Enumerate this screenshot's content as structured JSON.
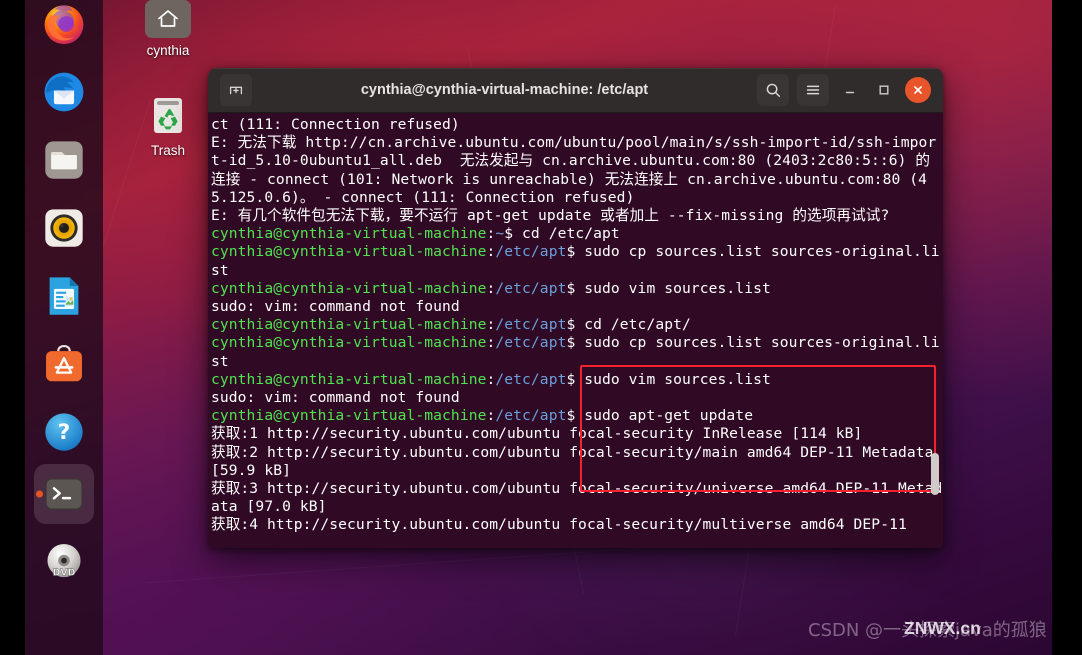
{
  "desktop": {
    "icons": [
      {
        "name": "home-folder",
        "label": "cynthia",
        "icon": "home-icon"
      },
      {
        "name": "trash",
        "label": "Trash",
        "icon": "trash-icon"
      }
    ]
  },
  "dock": {
    "items": [
      {
        "label": "Firefox",
        "icon": "firefox-icon",
        "active": false
      },
      {
        "label": "Thunderbird Mail",
        "icon": "thunderbird-icon",
        "active": false
      },
      {
        "label": "Files",
        "icon": "files-folder-icon",
        "active": false
      },
      {
        "label": "Rhythmbox",
        "icon": "rhythmbox-speaker-icon",
        "active": false
      },
      {
        "label": "LibreOffice Writer",
        "icon": "libreoffice-writer-icon",
        "active": false
      },
      {
        "label": "Ubuntu Software",
        "icon": "ubuntu-software-icon",
        "active": false
      },
      {
        "label": "Help",
        "icon": "help-question-icon",
        "active": false
      },
      {
        "label": "Terminal",
        "icon": "terminal-icon",
        "active": true
      },
      {
        "label": "DVD",
        "icon": "dvd-disc-icon",
        "active": false
      }
    ]
  },
  "terminal": {
    "title": "cynthia@cynthia-virtual-machine: /etc/apt",
    "titlebar": {
      "new_tab_label": "New Tab",
      "search_label": "Search",
      "menu_label": "Menu",
      "minimize_label": "Minimize",
      "maximize_label": "Maximize",
      "close_label": "Close"
    },
    "colors": {
      "background": "#300a24",
      "prompt_user": "#4fe44f",
      "prompt_path": "#6a9fdb",
      "text": "#ffffff",
      "annotation_red": "#f4212e",
      "close_button": "#e9552a"
    },
    "prompt": {
      "user_host": "cynthia@cynthia-virtual-machine",
      "path_home": "~",
      "path_apt": "/etc/apt",
      "symbol": "$"
    },
    "lines": [
      {
        "type": "out",
        "text": "ct (111: Connection refused)"
      },
      {
        "type": "out",
        "text": "E: 无法下载 http://cn.archive.ubuntu.com/ubuntu/pool/main/s/ssh-import-id/ssh-import-id_5.10-0ubuntu1_all.deb  无法发起与 cn.archive.ubuntu.com:80 (2403:2c80:5::6) 的连接 - connect (101: Network is unreachable) 无法连接上 cn.archive.ubuntu.com:80 (45.125.0.6)。 - connect (111: Connection refused)"
      },
      {
        "type": "out",
        "text": "E: 有几个软件包无法下载，要不运行 apt-get update 或者加上 --fix-missing 的选项再试试?"
      },
      {
        "type": "cmd",
        "path": "~",
        "command": "cd /etc/apt"
      },
      {
        "type": "cmd",
        "path": "/etc/apt",
        "command": "sudo cp sources.list sources-original.list"
      },
      {
        "type": "cmd",
        "path": "/etc/apt",
        "command": "sudo vim sources.list"
      },
      {
        "type": "out",
        "text": "sudo: vim: command not found"
      },
      {
        "type": "cmd",
        "path": "/etc/apt",
        "command": "cd /etc/apt/"
      },
      {
        "type": "cmd",
        "path": "/etc/apt",
        "command": "sudo cp sources.list sources-original.list"
      },
      {
        "type": "cmd",
        "path": "/etc/apt",
        "command": "sudo vim sources.list"
      },
      {
        "type": "out",
        "text": "sudo: vim: command not found"
      },
      {
        "type": "cmd",
        "path": "/etc/apt",
        "command": "sudo apt-get update"
      },
      {
        "type": "out",
        "text": "获取:1 http://security.ubuntu.com/ubuntu focal-security InRelease [114 kB]"
      },
      {
        "type": "out",
        "text": "获取:2 http://security.ubuntu.com/ubuntu focal-security/main amd64 DEP-11 Metadata [59.9 kB]"
      },
      {
        "type": "out",
        "text": "获取:3 http://security.ubuntu.com/ubuntu focal-security/universe amd64 DEP-11 Metadata [97.0 kB]"
      },
      {
        "type": "out",
        "text": "获取:4 http://security.ubuntu.com/ubuntu focal-security/multiverse amd64 DEP-11"
      }
    ],
    "annotation": {
      "note": "red rectangle highlighting typed commands",
      "highlighted_commands": [
        "cd /etc/apt/",
        "sudo cp sources.list sources-original.list",
        "sudo vim sources.list",
        "sudo apt-get update"
      ]
    }
  },
  "watermark": {
    "csdn": "CSDN @一头探索java的孤狼",
    "overlay": "ZNWX.cn"
  }
}
